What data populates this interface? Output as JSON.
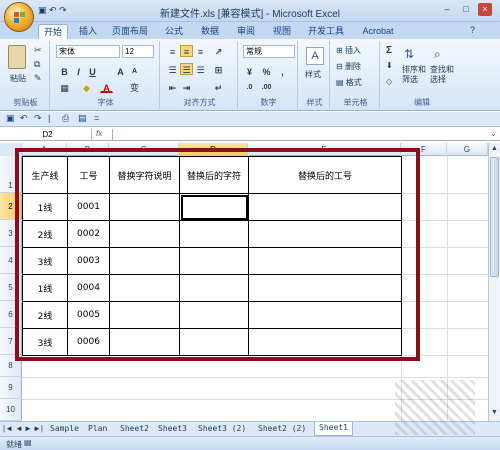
{
  "window": {
    "title": "新建文件.xls [兼容模式] - Microsoft Excel",
    "controls": {
      "minimize": "–",
      "maximize": "□",
      "close": "×"
    }
  },
  "quick_access": {
    "save_icon": "save-icon",
    "undo_icon": "undo-icon",
    "redo_icon": "redo-icon",
    "separator": "|",
    "dropdown": "="
  },
  "ribbon": {
    "tabs": [
      "开始",
      "插入",
      "页面布局",
      "公式",
      "数据",
      "审阅",
      "视图",
      "开发工具",
      "Acrobat"
    ],
    "active_tab": "开始",
    "clipboard": {
      "label": "剪贴板",
      "paste": "粘贴"
    },
    "font": {
      "label": "字体",
      "name": "宋体",
      "size": "12",
      "bold": "B",
      "italic": "I",
      "underline": "U",
      "grow": "A",
      "shrink": "A",
      "font_color": "A",
      "wen": "变"
    },
    "alignment": {
      "label": "对齐方式"
    },
    "number": {
      "label": "数字",
      "format": "常规",
      "currency": "¥",
      "percent": "%",
      "comma": ","
    },
    "styles": {
      "label": "样式",
      "button": "样式"
    },
    "cells": {
      "label": "单元格",
      "insert": "插入",
      "delete": "删除",
      "format": "格式"
    },
    "editing": {
      "label": "编辑",
      "sum": "Σ",
      "sort_filter": "排序和\n筛选",
      "find_select": "查找和\n选择"
    }
  },
  "formula_bar": {
    "name_box": "D2",
    "fx": "fx",
    "value": ""
  },
  "columns": [
    "A",
    "B",
    "C",
    "D",
    "E",
    "F",
    "G"
  ],
  "rows": [
    "1",
    "2",
    "3",
    "4",
    "5",
    "6",
    "7",
    "8",
    "9",
    "10"
  ],
  "table": {
    "headers": [
      "生产线",
      "工号",
      "替换字符说明",
      "替换后的字符",
      "替换后的工号"
    ],
    "rows": [
      [
        "1线",
        "0001",
        "",
        "",
        ""
      ],
      [
        "2线",
        "0002",
        "",
        "",
        ""
      ],
      [
        "3线",
        "0003",
        "",
        "",
        ""
      ],
      [
        "1线",
        "0004",
        "",
        "",
        ""
      ],
      [
        "2线",
        "0005",
        "",
        "",
        ""
      ],
      [
        "3线",
        "0006",
        "",
        "",
        ""
      ]
    ]
  },
  "sheet_tabs": [
    "Sample",
    "Plan",
    "Sheet2",
    "Sheet3",
    "Sheet3 (2)",
    "Sheet2 (2)",
    "Sheet1"
  ],
  "sheet_nav": [
    "|◄",
    "◄",
    "►",
    "►|"
  ],
  "status": {
    "ready": "就绪"
  }
}
